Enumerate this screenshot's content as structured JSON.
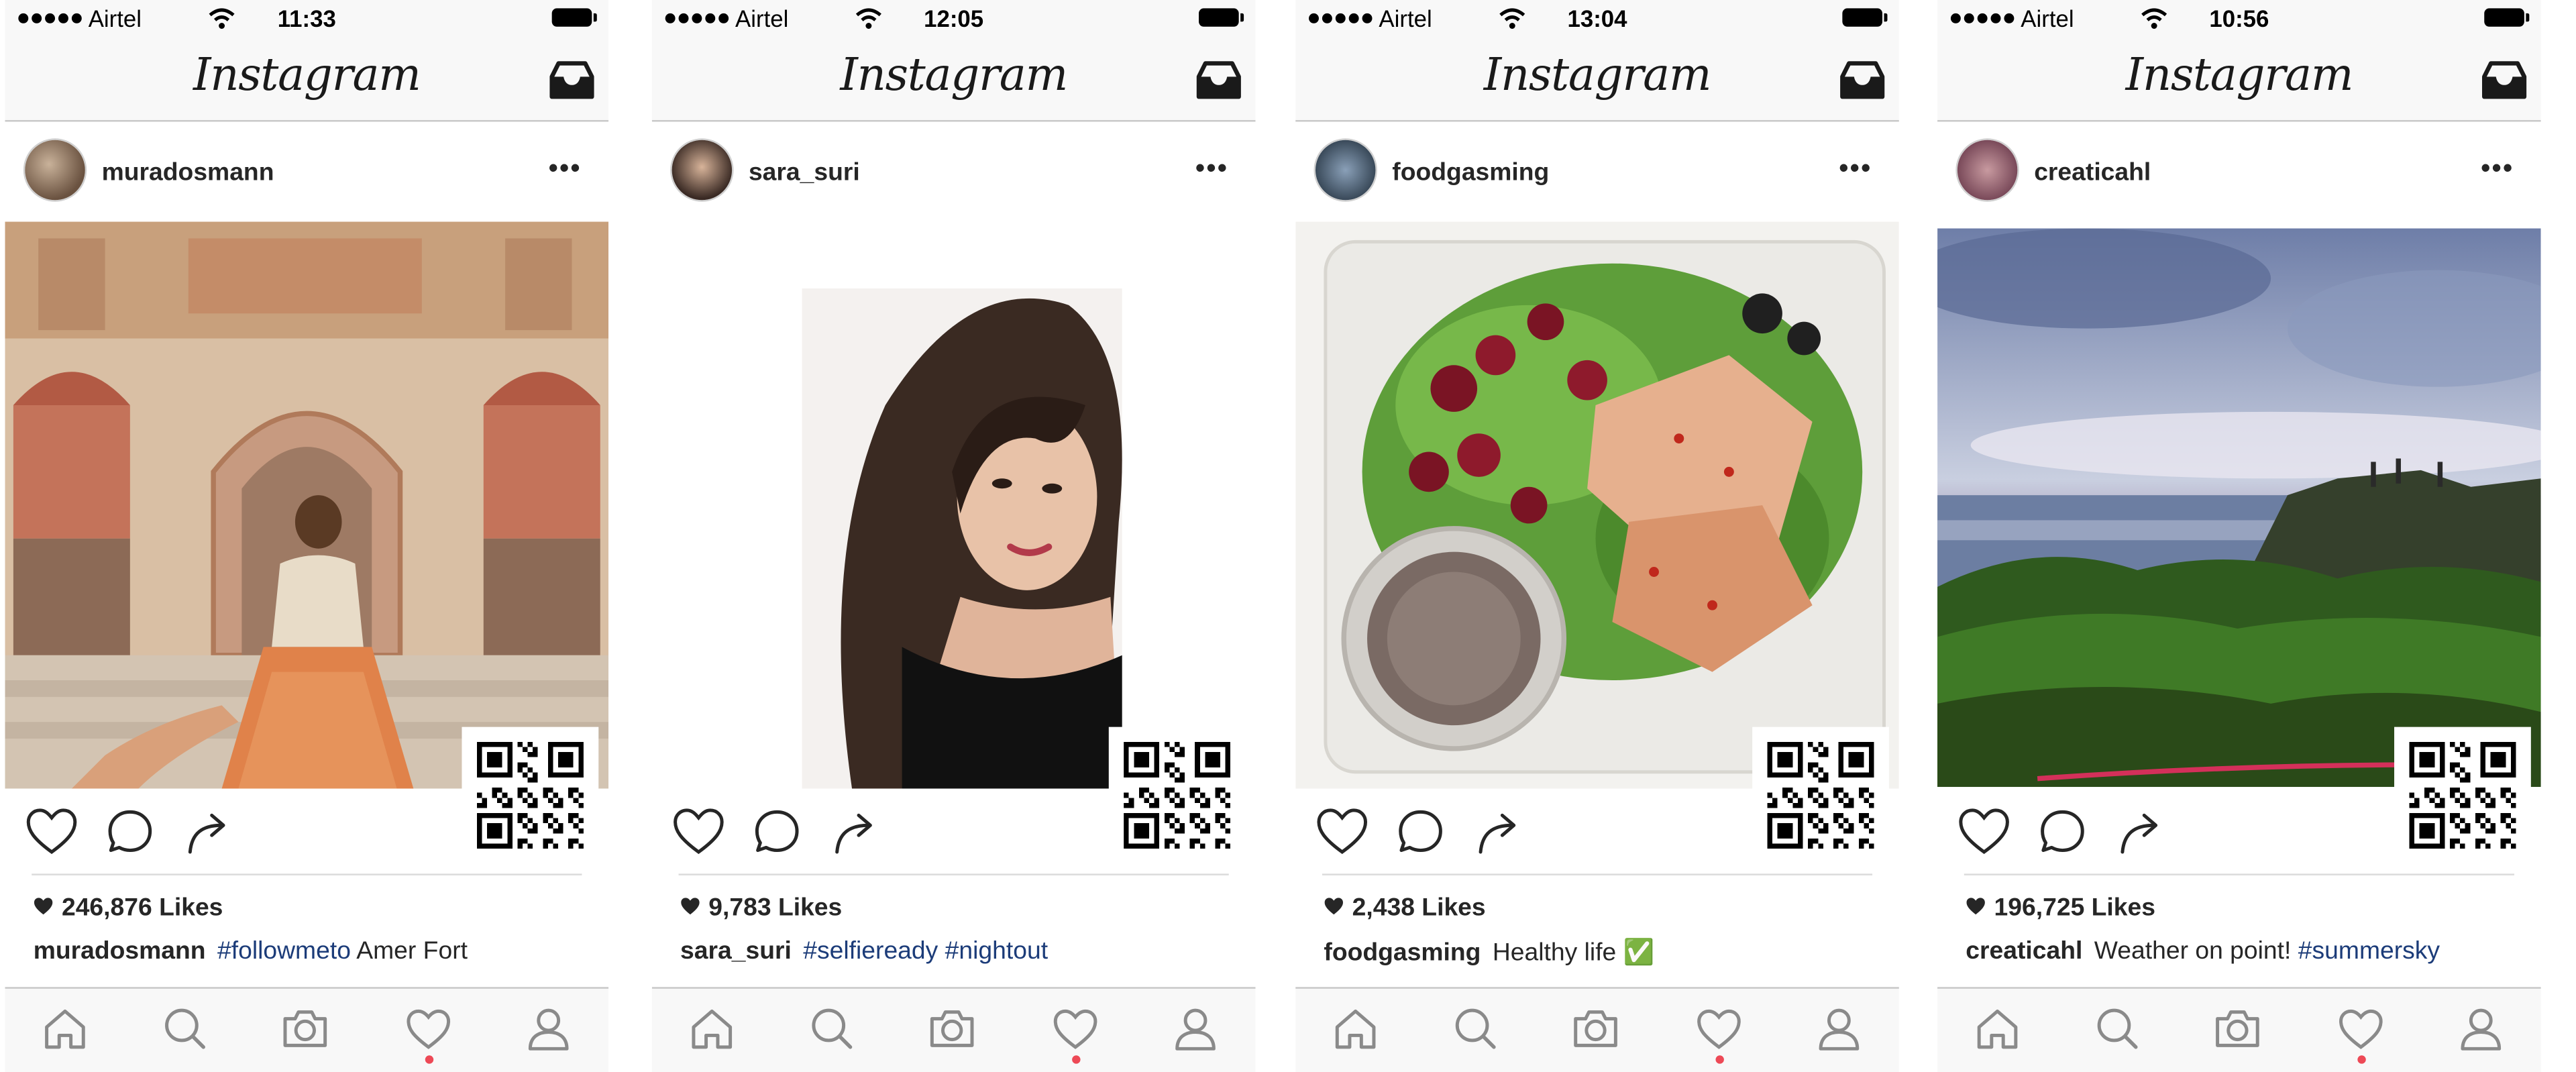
{
  "colors": {
    "notification_dot": "#ed4956",
    "hashtag": "#1c3c79",
    "bar_background": "#f8f8f8"
  },
  "app": {
    "logo": "Instagram"
  },
  "icons": {
    "status": [
      "signal-dots-icon",
      "wifi-icon",
      "battery-icon"
    ],
    "navbar": [
      "inbox-icon"
    ],
    "post_actions": [
      "heart-icon",
      "comment-icon",
      "share-icon"
    ],
    "tabs": [
      "home-icon",
      "search-icon",
      "camera-icon",
      "heart-icon",
      "profile-icon"
    ]
  },
  "phones": [
    {
      "carrier": "Airtel",
      "time": "11:33",
      "username": "muradosmann",
      "more": "•••",
      "likes": "246,876 Likes",
      "caption_user": "muradosmann",
      "caption_parts": [
        {
          "text": "#followmeto",
          "hashtag": true
        },
        {
          "text": "Amer Fort",
          "hashtag": false
        }
      ]
    },
    {
      "carrier": "Airtel",
      "time": "12:05",
      "username": "sara_suri",
      "more": "•••",
      "likes": "9,783 Likes",
      "caption_user": "sara_suri",
      "caption_parts": [
        {
          "text": "#selfieready",
          "hashtag": true
        },
        {
          "text": "#nightout",
          "hashtag": true
        }
      ]
    },
    {
      "carrier": "Airtel",
      "time": "13:04",
      "username": "foodgasming",
      "more": "•••",
      "likes": "2,438 Likes",
      "caption_user": "foodgasming",
      "caption_parts": [
        {
          "text": "Healthy life",
          "hashtag": false
        },
        {
          "text": "✅",
          "hashtag": false
        }
      ]
    },
    {
      "carrier": "Airtel",
      "time": "10:56",
      "username": "creaticahl",
      "more": "•••",
      "likes": "196,725 Likes",
      "caption_user": "creaticahl",
      "caption_parts": [
        {
          "text": "Weather on point!",
          "hashtag": false
        },
        {
          "text": "#summersky",
          "hashtag": true
        }
      ]
    }
  ]
}
